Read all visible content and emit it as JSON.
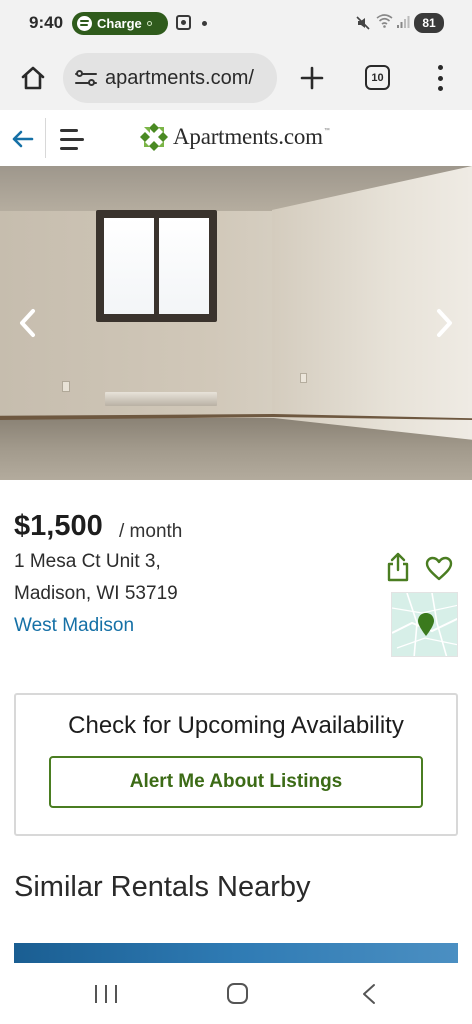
{
  "status_bar": {
    "time": "9:40",
    "charge_label": "Charge",
    "battery": "81",
    "icons": [
      "spotify-icon",
      "screenshot-icon",
      "notification-dot",
      "mute-icon",
      "wifi-icon",
      "signal-icon",
      "battery-icon"
    ]
  },
  "browser": {
    "url": "apartments.com/",
    "tab_count": "10",
    "icons": [
      "home-icon",
      "tune-icon",
      "plus-icon",
      "tabs-icon",
      "more-vert-icon"
    ]
  },
  "site_header": {
    "logo_text": "Apartments.com",
    "logo_tm": "™",
    "brand_color": "#4a7d21",
    "link_color": "#1570a6"
  },
  "listing": {
    "price": "$1,500",
    "per_month": "/ month",
    "address_line1": "1 Mesa Ct Unit 3,",
    "address_line2": "Madison, WI 53719",
    "neighborhood": "West Madison"
  },
  "availability": {
    "title": "Check for Upcoming Availability",
    "button_label": "Alert Me About Listings"
  },
  "similar": {
    "heading": "Similar Rentals Nearby"
  }
}
